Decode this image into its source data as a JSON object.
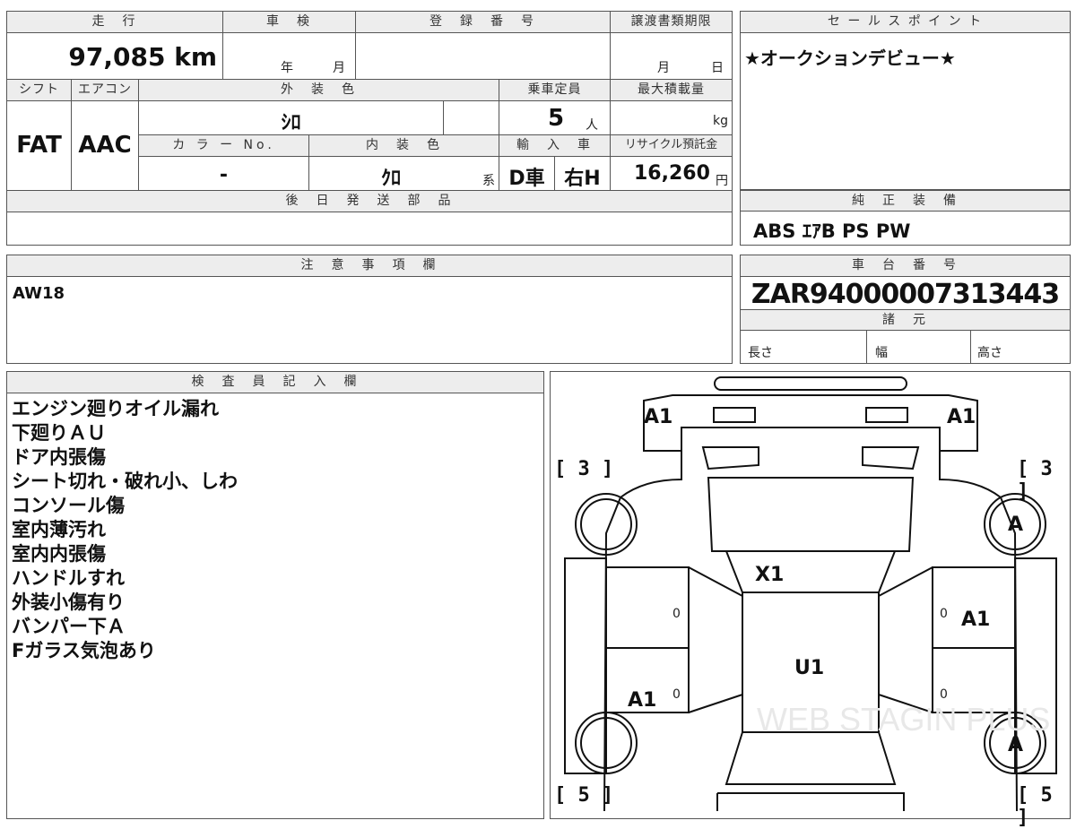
{
  "vehicle": {
    "mileage_label": "走　行",
    "mileage_value": "97,085 km",
    "inspection_label": "車　検",
    "inspection_year": "年",
    "inspection_month": "月",
    "registration_label": "登　録　番　号",
    "transfer_deadline_label": "譲渡書類期限",
    "transfer_month": "月",
    "transfer_day": "日",
    "shift_label": "シフト",
    "shift_value": "FAT",
    "aircon_label": "エアコン",
    "aircon_value": "AAC",
    "exterior_color_label": "外　装　色",
    "exterior_color_value": "ｼﾛ",
    "capacity_label": "乗車定員",
    "capacity_value": "5",
    "capacity_unit": "人",
    "max_load_label": "最大積載量",
    "max_load_unit": "kg",
    "color_no_label": "カ ラ ー No.",
    "color_no_value": "-",
    "interior_color_label": "内　装　色",
    "interior_color_value": "ｸﾛ",
    "interior_color_suffix": "系",
    "import_label": "輸　入　車",
    "import_value_1": "D車",
    "import_value_2": "右H",
    "recycle_label": "リサイクル預託金",
    "recycle_value": "16,260",
    "recycle_unit": "円",
    "later_parts_label": "後　日　発　送　部　品"
  },
  "sales_point": {
    "label": "セ ー ル ス ポ イ ン ト",
    "text": "★オークションデビュー★"
  },
  "equipment": {
    "label": "純　正　装　備",
    "text": "ABS ｴｱB PS PW"
  },
  "notes": {
    "label": "注　意　事　項　欄",
    "text": "AW18"
  },
  "chassis": {
    "label": "車　台　番　号",
    "value": "ZAR94000007313443",
    "specs_label": "諸　元",
    "length_label": "長さ",
    "width_label": "幅",
    "height_label": "高さ"
  },
  "inspector": {
    "label": "検　査　員　記　入　欄",
    "lines": [
      "エンジン廻りオイル漏れ",
      "下廻りＡＵ",
      "ドア内張傷",
      "シート切れ・破れ小、しわ",
      "コンソール傷",
      "室内薄汚れ",
      "室内内張傷",
      "ハンドルすれ",
      "外装小傷有り",
      "バンパー下Ａ",
      "Fガラス気泡あり"
    ]
  },
  "diagram": {
    "marks": {
      "front_left": "A1",
      "front_right": "A1",
      "tread_front_left": "3",
      "tread_front_right": "3",
      "wheel_front_right": "A",
      "windshield": "X1",
      "door_right_front": "A1",
      "roof": "U1",
      "door_left_rear": "A1",
      "wheel_rear_right": "A",
      "tread_rear_left": "5",
      "tread_rear_right": "5",
      "zero_1": "0",
      "zero_2": "0",
      "zero_3": "0",
      "zero_4": "0"
    },
    "watermark": "WEB STAGIN PLUS"
  }
}
